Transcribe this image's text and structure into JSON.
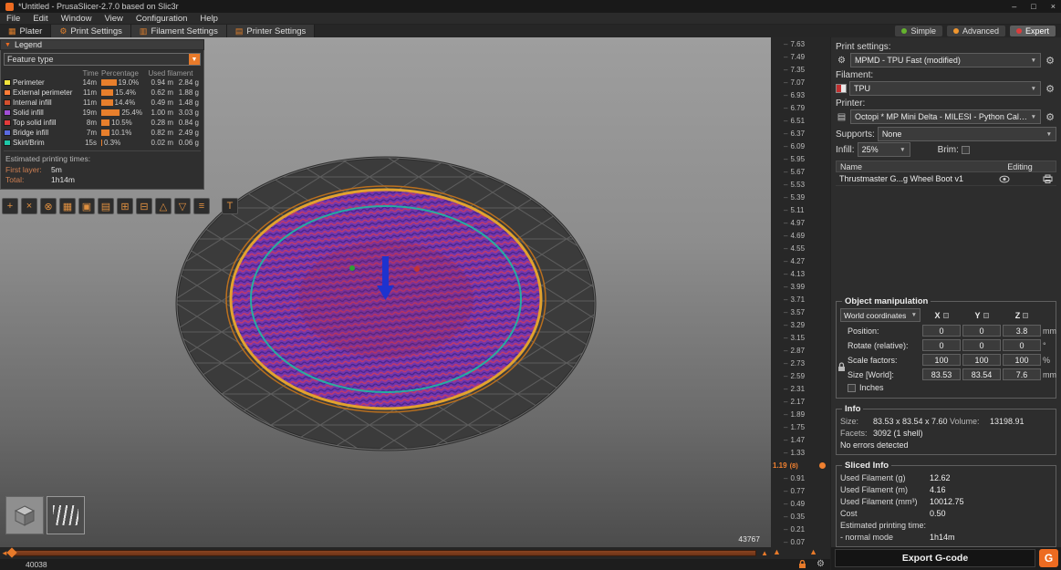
{
  "window": {
    "title": "*Untitled - PrusaSlicer-2.7.0 based on Slic3r",
    "controls": [
      "minimize",
      "maximize",
      "close"
    ]
  },
  "menu": [
    "File",
    "Edit",
    "Window",
    "View",
    "Configuration",
    "Help"
  ],
  "tabs": [
    {
      "label": "Plater",
      "icon": "plater-icon",
      "active": true
    },
    {
      "label": "Print Settings",
      "icon": "print-settings-icon",
      "active": false
    },
    {
      "label": "Filament Settings",
      "icon": "filament-settings-icon",
      "active": false
    },
    {
      "label": "Printer Settings",
      "icon": "printer-settings-icon",
      "active": false
    }
  ],
  "modes": [
    {
      "label": "Simple",
      "dot": "#65b32e",
      "active": false
    },
    {
      "label": "Advanced",
      "dot": "#f0962e",
      "active": false
    },
    {
      "label": "Expert",
      "dot": "#dc3c3c",
      "active": true
    }
  ],
  "accent_color": "#ED6B21",
  "legend": {
    "title": "Legend",
    "feature_type": "Feature type",
    "columns": [
      "Time",
      "Percentage",
      "Used filament"
    ],
    "rows": [
      {
        "name": "Perimeter",
        "color": "#f2e43c",
        "time": "14m",
        "pct": "19.0%",
        "pct_value": 19.0,
        "length": "0.94 m",
        "weight": "2.84 g"
      },
      {
        "name": "External perimeter",
        "color": "#ff7d38",
        "time": "11m",
        "pct": "15.4%",
        "pct_value": 15.4,
        "length": "0.62 m",
        "weight": "1.88 g"
      },
      {
        "name": "Internal infill",
        "color": "#d4502e",
        "time": "11m",
        "pct": "14.4%",
        "pct_value": 14.4,
        "length": "0.49 m",
        "weight": "1.48 g"
      },
      {
        "name": "Solid infill",
        "color": "#a14fd6",
        "time": "19m",
        "pct": "25.4%",
        "pct_value": 25.4,
        "length": "1.00 m",
        "weight": "3.03 g"
      },
      {
        "name": "Top solid infill",
        "color": "#e43b3b",
        "time": "8m",
        "pct": "10.5%",
        "pct_value": 10.5,
        "length": "0.28 m",
        "weight": "0.84 g"
      },
      {
        "name": "Bridge infill",
        "color": "#5b6ae0",
        "time": "7m",
        "pct": "10.1%",
        "pct_value": 10.1,
        "length": "0.82 m",
        "weight": "2.49 g"
      },
      {
        "name": "Skirt/Brim",
        "color": "#1ec8a8",
        "time": "15s",
        "pct": "0.3%",
        "pct_value": 0.3,
        "length": "0.02 m",
        "weight": "0.06 g"
      }
    ],
    "times_title": "Estimated printing times:",
    "first_layer_label": "First layer:",
    "first_layer_value": "5m",
    "total_label": "Total:",
    "total_value": "1h14m"
  },
  "toolbar": {
    "icons": [
      "add",
      "delete",
      "delete-all",
      "arrange",
      "copy",
      "paste",
      "add-instance",
      "remove-instance",
      "split-to-objects",
      "split-to-parts",
      "variable-layer-height",
      "text-tool"
    ]
  },
  "viewport": {
    "bed_color": "#3b3b3b",
    "perimeter_color": "#e2a22e",
    "infill_color": "#7436ae",
    "skirt_color": "#19c2a2",
    "gizmo_arrow_color": "#1d33cf"
  },
  "layer_slider": {
    "ticks": [
      "7.63",
      "7.49",
      "7.35",
      "7.07",
      "6.93",
      "6.79",
      "6.51",
      "6.37",
      "6.09",
      "5.95",
      "5.67",
      "5.53",
      "5.39",
      "5.11",
      "4.97",
      "4.69",
      "4.55",
      "4.27",
      "4.13",
      "3.99",
      "3.71",
      "3.57",
      "3.29",
      "3.15",
      "2.87",
      "2.73",
      "2.59",
      "2.31",
      "2.17",
      "1.89",
      "1.75",
      "1.47",
      "1.33",
      "0.91",
      "0.77",
      "0.49",
      "0.35",
      "0.21",
      "0.07"
    ],
    "current_value": "1.19",
    "current_count": "(8)",
    "current_index": 33
  },
  "bottom_slider": {
    "left_value": "40038",
    "right_value": "43767"
  },
  "panel": {
    "print_settings_label": "Print settings:",
    "print_settings_value": "MPMD - TPU Fast (modified)",
    "filament_label": "Filament:",
    "filament_value": "TPU",
    "printer_label": "Printer:",
    "printer_value": "Octopi * MP Mini Delta - MILESI - Python Calibrated",
    "supports_label": "Supports:",
    "supports_value": "None",
    "infill_label": "Infill:",
    "infill_value": "25%",
    "brim_label": "Brim:",
    "list": {
      "name_col": "Name",
      "editing_col": "Editing",
      "rows": [
        {
          "name": "Thrustmaster G...g Wheel Boot v1"
        }
      ]
    },
    "manipulation": {
      "title": "Object manipulation",
      "coords": "World coordinates",
      "axes": [
        "X",
        "Y",
        "Z"
      ],
      "rows": [
        {
          "label": "Position:",
          "values": [
            "0",
            "0",
            "3.8"
          ],
          "unit": "mm"
        },
        {
          "label": "Rotate (relative):",
          "values": [
            "0",
            "0",
            "0"
          ],
          "unit": "°"
        },
        {
          "label": "Scale factors:",
          "values": [
            "100",
            "100",
            "100"
          ],
          "unit": "%"
        },
        {
          "label": "Size [World]:",
          "values": [
            "83.53",
            "83.54",
            "7.6"
          ],
          "unit": "mm"
        }
      ],
      "inches_label": "Inches"
    },
    "info": {
      "title": "Info",
      "size_label": "Size:",
      "size_value": "83.53 x 83.54 x 7.60",
      "volume_label": "Volume:",
      "volume_value": "13198.91",
      "facets_label": "Facets:",
      "facets_value": "3092 (1 shell)",
      "status": "No errors detected"
    },
    "sliced": {
      "title": "Sliced Info",
      "rows": [
        {
          "label": "Used Filament (g)",
          "value": "12.62"
        },
        {
          "label": "Used Filament (m)",
          "value": "4.16"
        },
        {
          "label": "Used Filament (mm³)",
          "value": "10012.75"
        },
        {
          "label": "Cost",
          "value": "0.50"
        }
      ],
      "time_label": "Estimated printing time:",
      "mode_label": "- normal mode",
      "mode_value": "1h14m"
    },
    "export_label": "Export G-code",
    "gcode_badge": "G"
  }
}
